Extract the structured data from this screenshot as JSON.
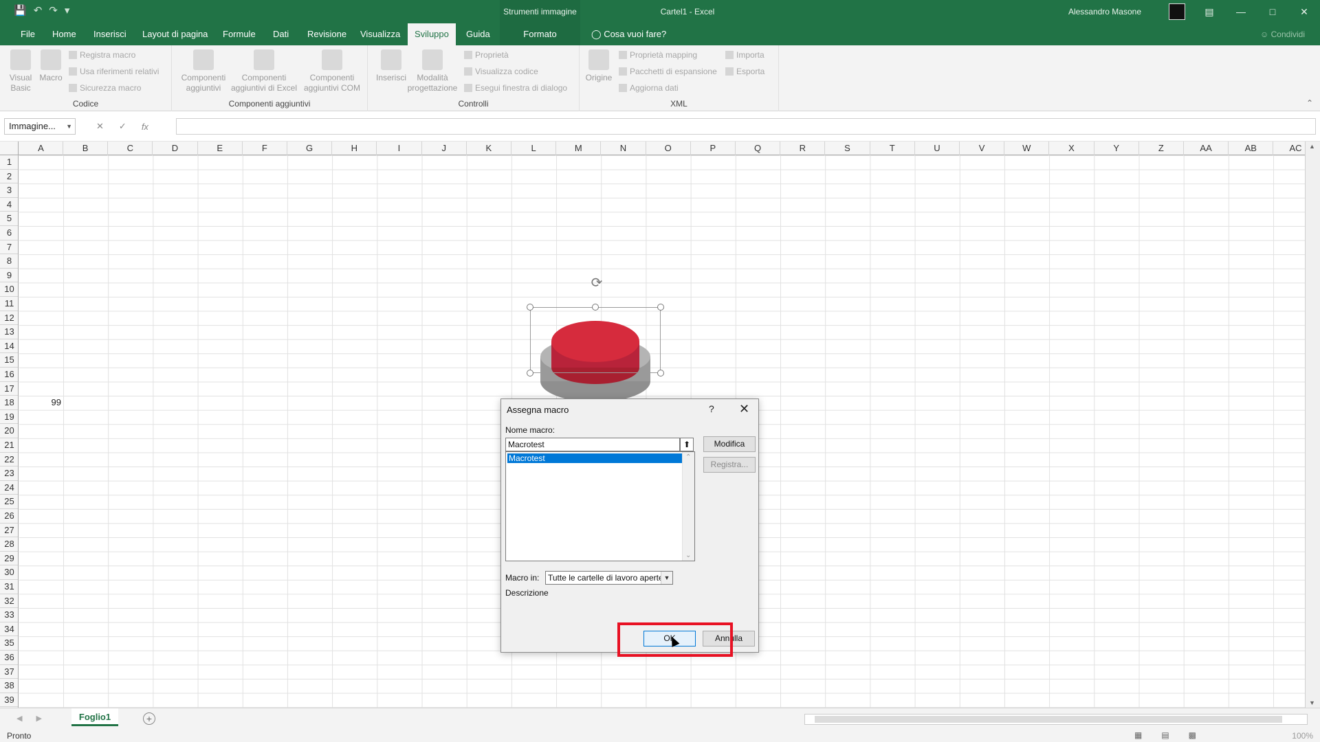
{
  "titlebar": {
    "context_tab": "Strumenti immagine",
    "doc_title": "Cartel1  -  Excel",
    "user": "Alessandro Masone",
    "qat_icons": [
      "save-icon",
      "undo-icon",
      "redo-icon",
      "customize-icon"
    ],
    "window_icons": [
      "ribbon-display-icon",
      "minimize-icon",
      "maximize-icon",
      "close-icon"
    ]
  },
  "tabs": {
    "items": [
      "File",
      "Home",
      "Inserisci",
      "Layout di pagina",
      "Formule",
      "Dati",
      "Revisione",
      "Visualizza",
      "Sviluppo",
      "Guida"
    ],
    "formato": "Formato",
    "tell_me": "Cosa vuoi fare?",
    "share": "Condividi",
    "active": "Sviluppo"
  },
  "ribbon": {
    "codice": {
      "label": "Codice",
      "visual_basic": "Visual Basic",
      "macro": "Macro",
      "registra": "Registra macro",
      "riferimenti": "Usa riferimenti relativi",
      "sicurezza": "Sicurezza macro"
    },
    "componenti": {
      "label": "Componenti aggiuntivi",
      "comp1": "Componenti aggiuntivi",
      "comp2": "Componenti aggiuntivi di Excel",
      "comp3": "Componenti aggiuntivi COM"
    },
    "controlli": {
      "label": "Controlli",
      "inserisci": "Inserisci",
      "modalita": "Modalità progettazione",
      "proprieta": "Proprietà",
      "codice": "Visualizza codice",
      "finestra": "Esegui finestra di dialogo"
    },
    "xml": {
      "label": "XML",
      "origine": "Origine",
      "mapping": "Proprietà mapping",
      "pacchetti": "Pacchetti di espansione",
      "aggiorna": "Aggiorna dati",
      "importa": "Importa",
      "esporta": "Esporta"
    }
  },
  "formula_bar": {
    "namebox": "Immagine...",
    "fx": "fx",
    "value": ""
  },
  "grid": {
    "columns": [
      "A",
      "B",
      "C",
      "D",
      "E",
      "F",
      "G",
      "H",
      "I",
      "J",
      "K",
      "L",
      "M",
      "N",
      "O",
      "P",
      "Q",
      "R",
      "S",
      "T",
      "U",
      "V",
      "W",
      "X",
      "Y",
      "Z",
      "AA",
      "AB",
      "AC"
    ],
    "rows": [
      "1",
      "2",
      "3",
      "4",
      "5",
      "6",
      "7",
      "8",
      "9",
      "10",
      "11",
      "12",
      "13",
      "14",
      "15",
      "16",
      "17",
      "18",
      "19",
      "20",
      "21",
      "22",
      "23",
      "24",
      "25",
      "26",
      "27",
      "28",
      "29",
      "30",
      "31",
      "32",
      "33",
      "34",
      "35",
      "36",
      "37",
      "38",
      "39"
    ],
    "cell_A8": "99"
  },
  "sheets": {
    "active": "Foglio1"
  },
  "status": {
    "text": "Pronto",
    "zoom": "100%"
  },
  "dialog": {
    "title": "Assegna macro",
    "help": "?",
    "close": "✕",
    "nome_label": "Nome macro:",
    "nome_value": "Macrotest",
    "list_items": [
      "Macrotest"
    ],
    "modifica": "Modifica",
    "registra": "Registra...",
    "macro_in_label": "Macro in:",
    "macro_in_value": "Tutte le cartelle di lavoro aperte",
    "descrizione": "Descrizione",
    "ok": "OK",
    "annulla": "Annulla"
  },
  "colors": {
    "excel_green": "#217346",
    "highlight_red": "#e81123",
    "button_red": "#d62b3d"
  }
}
